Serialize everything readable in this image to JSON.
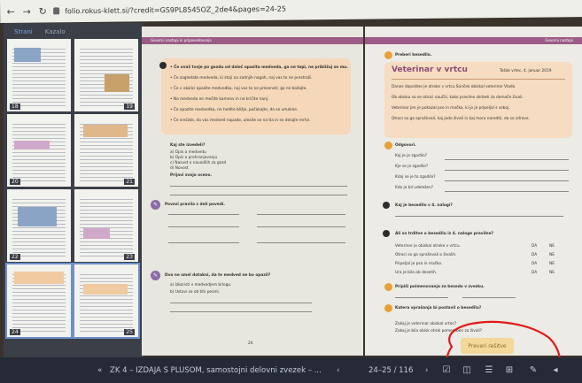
{
  "browser": {
    "url": "folio.rokus-klett.si/?credit=GS9PL8545OZ_2de4&pages=24-25"
  },
  "sidebar": {
    "tabs": [
      "Strani",
      "Kazalo"
    ],
    "page_numbers": [
      "18",
      "19",
      "20",
      "21",
      "22",
      "23",
      "24",
      "25"
    ]
  },
  "left_page": {
    "header": "Govorni nastopi in pripovedovanje",
    "page_number": "24",
    "box_lines": [
      "• Če ovaš tvoje po gozdu od daleč opazita medveda, ga ne tepi, ne približuj se mu.",
      "• Če zagledate medveda, ki stoji na zadnjih nogah, naj vas to ne prestraši.",
      "• Če v okolici opazite medvedka, naj vas to ne preseneti; ga ne božajte.",
      "• Na medveda ne mečite kamnov in ne kričite nanj.",
      "• Če opazite medvedka, ne hodite bližje, počakajte, da se umakne.",
      "• Če srečate, da vas medved napade, ulezite se na tla in se delajte mrtvi."
    ],
    "q_title": "Kaj ste izvedeli?",
    "q_options": [
      "a) Opis o medvedu",
      "b) Opis o prehranjevanju",
      "c) Nasvet o navodilih za gozd",
      "d) Novost"
    ],
    "q_sentence": "Prijavi svojo oceno.",
    "section1": "Povezi pravila z deli povedi.",
    "section2": "Dva ne smel dotakni, da te medved ne bo opazil?",
    "section2_items": [
      "a) Izkoristi v medvedjem brlogu.",
      "b) Ustavi se ob tihi pesmi."
    ]
  },
  "right_page": {
    "header": "Govorni nastopi",
    "tag": "Preberi besedilo.",
    "title": "Veterinar v vrtcu",
    "date": "Težak vrtec, 4. januar 2019",
    "box_lines": [
      "Danes dopoldne je otroke v vrtcu Sonček obiskal veterinar Vlado.",
      "Ob obisku so se otroci naučili, kako pravilno skrbeti za domače živali.",
      "Veterinar jim je pokazal pse in mačko, ki jo je pripeljal s seboj.",
      "Otroci so ga spraševali, kaj jedo živali in kaj mora narediti, da so zdrave."
    ],
    "section1": "Odgovori.",
    "questions": [
      "Kaj je je zgodilo?",
      "Kje se je zgodilo?",
      "Kdaj se je to zgodilo?",
      "Kdo je bil udeležen?"
    ],
    "section2": "Kaj je besedilo v 4. nalogi?",
    "section3": "Ali so trditve o besedilu iz 4. naloge pravilne?",
    "true_false": [
      {
        "q": "Veterinar je obiskal otroke v vrtcu.",
        "a": "DA",
        "b": "NE"
      },
      {
        "q": "Otroci so ga spraševali o živalih.",
        "a": "DA",
        "b": "NE"
      },
      {
        "q": "Pripeljal je psa in mačko.",
        "a": "DA",
        "b": "NE"
      },
      {
        "q": "Ura je bila ob desetih.",
        "a": "DA",
        "b": "NE"
      }
    ],
    "section4": "Pripiši poimenovanja za besedo v zvezku.",
    "section5": "Katera vprašanja bi postavil o besedilu?",
    "lower_lines": [
      "Zakaj je veterinar obiskal vrtec?",
      "Zakaj je bila obisk otrok pomemben za živali?"
    ],
    "button_label": "Preveri rešitve"
  },
  "toolbar": {
    "prev_label": "«",
    "book_title": "ZK 4 – IZDAJA S PLUSOM, samostojni delovni zvezek – ...",
    "back_label": "‹",
    "page_indicator": "24–25 / 116",
    "next_label": "›"
  }
}
